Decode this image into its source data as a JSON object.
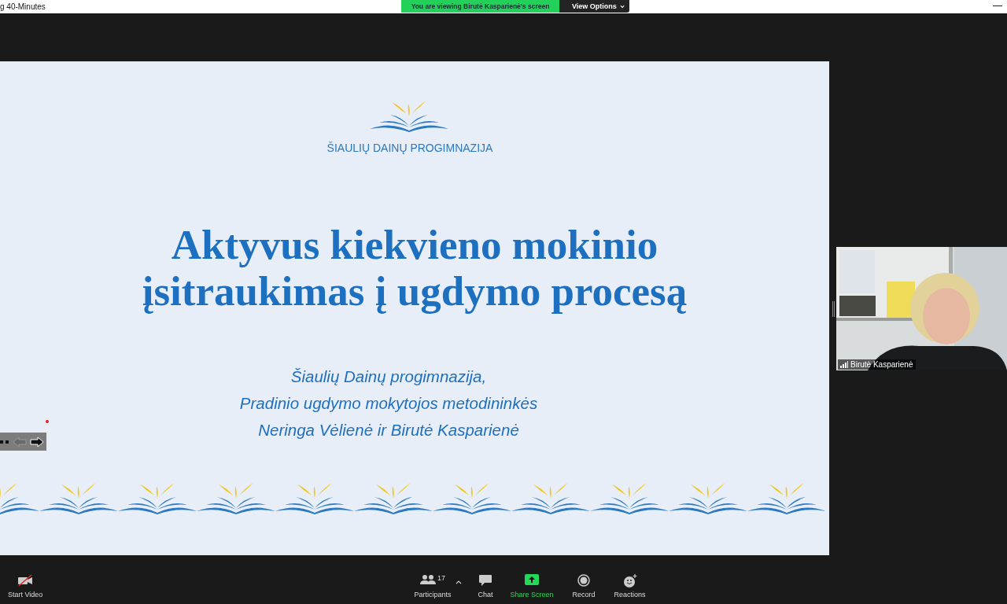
{
  "top_bar": {
    "title": "g 40-Minutes",
    "banner": "You are viewing Birutė Kasparienė's screen",
    "view_options": "View Options"
  },
  "slide": {
    "school": "ŠIAULIŲ DAINŲ PROGIMNAZIJA",
    "title_lines": [
      "Aktyvus kiekvieno mokinio",
      "įsitraukimas į ugdymo procesą"
    ],
    "subtitle_lines": [
      "Šiaulių Dainų progimnazija,",
      "Pradinio ugdymo mokytojos metodininkės",
      "Neringa Vėlienė ir Birutė Kasparienė"
    ]
  },
  "video_tile": {
    "kind": "picture",
    "name": "Birutė Kasparienė"
  },
  "toolbar": [
    {
      "kind": "video",
      "label": "Start Video"
    },
    {
      "kind": "participants",
      "label": "Participants",
      "count": "17"
    },
    {
      "kind": "chat",
      "label": "Chat"
    },
    {
      "kind": "share",
      "label": "Share Screen"
    },
    {
      "kind": "record",
      "label": "Record"
    },
    {
      "kind": "reactions",
      "label": "Reactions"
    }
  ]
}
